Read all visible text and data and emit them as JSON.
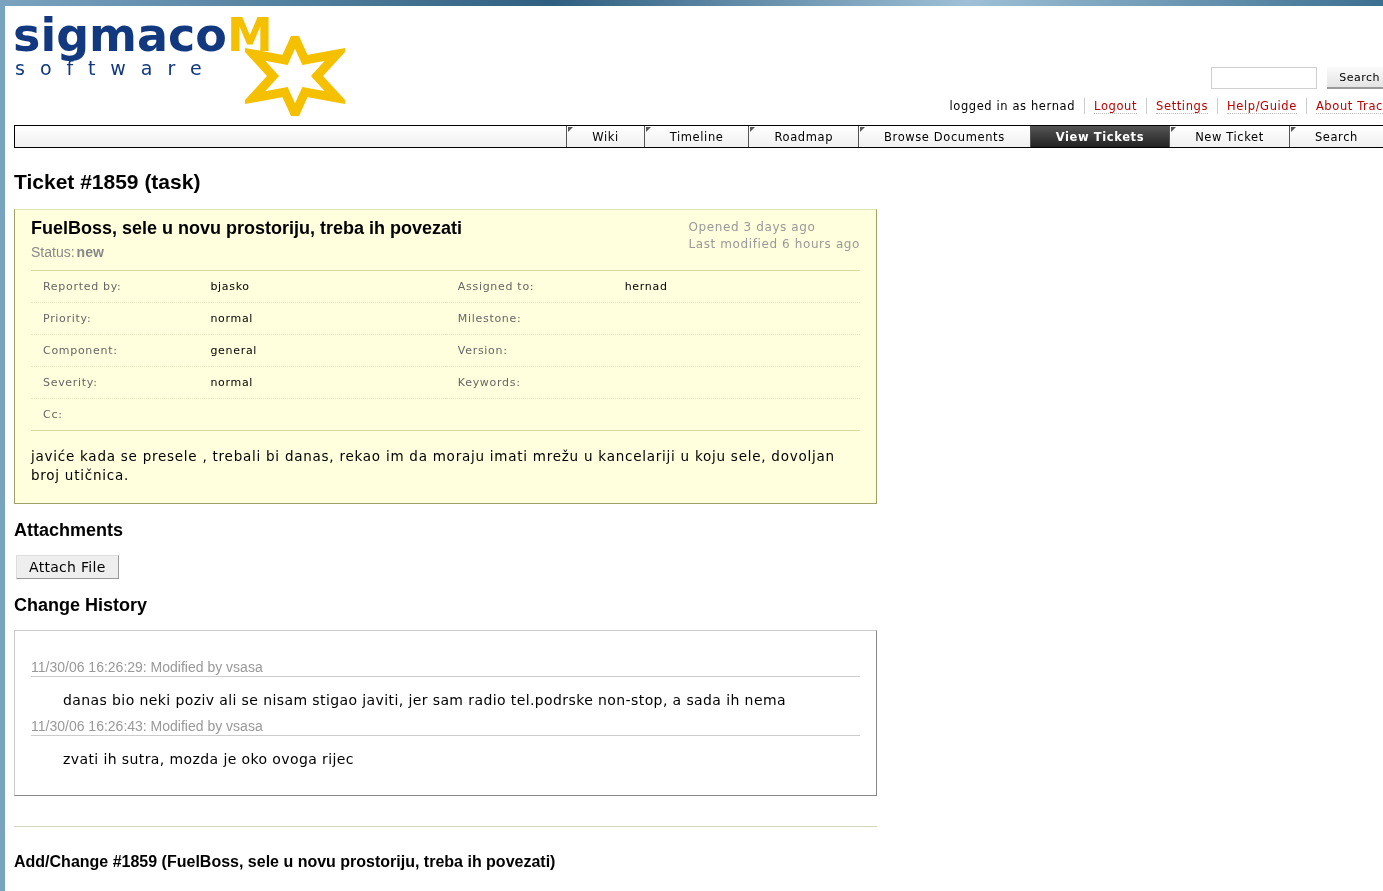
{
  "logo": {
    "name_main": "sigmaco",
    "name_accent": "M",
    "tagline": "software"
  },
  "search": {
    "button": "Search"
  },
  "meta_nav": [
    {
      "label": "logged in as hernad",
      "kind": "text"
    },
    {
      "label": "Logout",
      "kind": "link"
    },
    {
      "label": "Settings",
      "kind": "link"
    },
    {
      "label": "Help/Guide",
      "kind": "link"
    },
    {
      "label": "About Trac",
      "kind": "link"
    }
  ],
  "main_nav": [
    {
      "label": "Wiki",
      "selected": false
    },
    {
      "label": "Timeline",
      "selected": false
    },
    {
      "label": "Roadmap",
      "selected": false
    },
    {
      "label": "Browse Documents",
      "selected": false
    },
    {
      "label": "View Tickets",
      "selected": true
    },
    {
      "label": "New Ticket",
      "selected": false
    },
    {
      "label": "Search",
      "selected": false
    }
  ],
  "page_title": "Ticket #1859 (task)",
  "ticket": {
    "summary": "FuelBoss, sele u novu prostoriju, treba ih povezati",
    "status_label": "Status:",
    "status": "new",
    "opened": "Opened 3 days ago",
    "modified": "Last modified 6 hours ago",
    "properties": [
      [
        {
          "label": "Reported by:",
          "value": "bjasko"
        },
        {
          "label": "Assigned to:",
          "value": "hernad"
        }
      ],
      [
        {
          "label": "Priority:",
          "value": "normal"
        },
        {
          "label": "Milestone:"
        }
      ],
      [
        {
          "label": "Component:",
          "value": "general"
        },
        {
          "label": "Version:"
        }
      ],
      [
        {
          "label": "Severity:",
          "value": "normal"
        },
        {
          "label": "Keywords:"
        }
      ],
      [
        {
          "label": "Cc:"
        }
      ]
    ],
    "description": "javiće kada se presele , trebali bi danas, rekao im da moraju imati mrežu u kancelariji u koju sele, dovoljan broj utičnica."
  },
  "attachments": {
    "title": "Attachments",
    "button": "Attach File"
  },
  "history": {
    "title": "Change History",
    "changes": [
      {
        "header": "11/30/06 16:26:29: Modified by vsasa",
        "comment": "danas bio neki poziv ali se nisam stigao javiti, jer sam radio tel.podrske non-stop, a sada ih nema"
      },
      {
        "header": "11/30/06 16:26:43: Modified by vsasa",
        "comment": "zvati ih sutra, mozda je oko ovoga rijec"
      }
    ]
  },
  "add_change_title": "Add/Change #1859 (FuelBoss, sele u novu prostoriju, treba ih povezati)"
}
